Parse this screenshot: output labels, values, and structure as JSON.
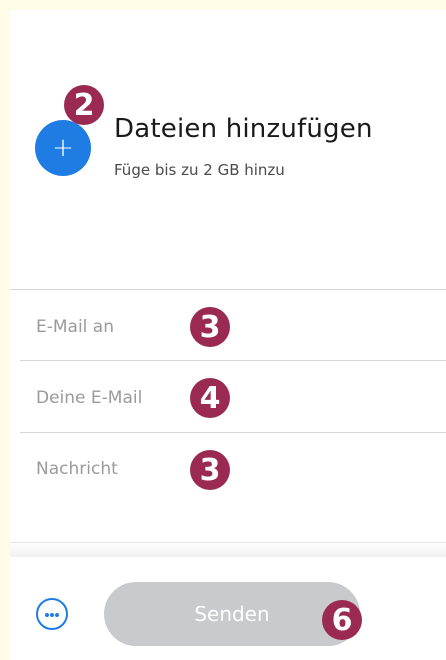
{
  "upload": {
    "title": "Dateien hinzufügen",
    "subtitle": "Füge bis zu 2 GB hinzu",
    "add_icon": "plus-icon",
    "add_glyph": "+"
  },
  "form": {
    "to_placeholder": "E-Mail an",
    "from_placeholder": "Deine E-Mail",
    "message_placeholder": "Nachricht"
  },
  "footer": {
    "more_icon": "more-options-icon",
    "send_label": "Senden"
  },
  "annotations": {
    "add": "2",
    "to": "3",
    "from": "4",
    "message": "3",
    "send": "6"
  },
  "colors": {
    "accent": "#1f7ce3",
    "badge": "#9a2a52",
    "send_disabled": "#c8cacd",
    "background": "#fefbe6"
  }
}
